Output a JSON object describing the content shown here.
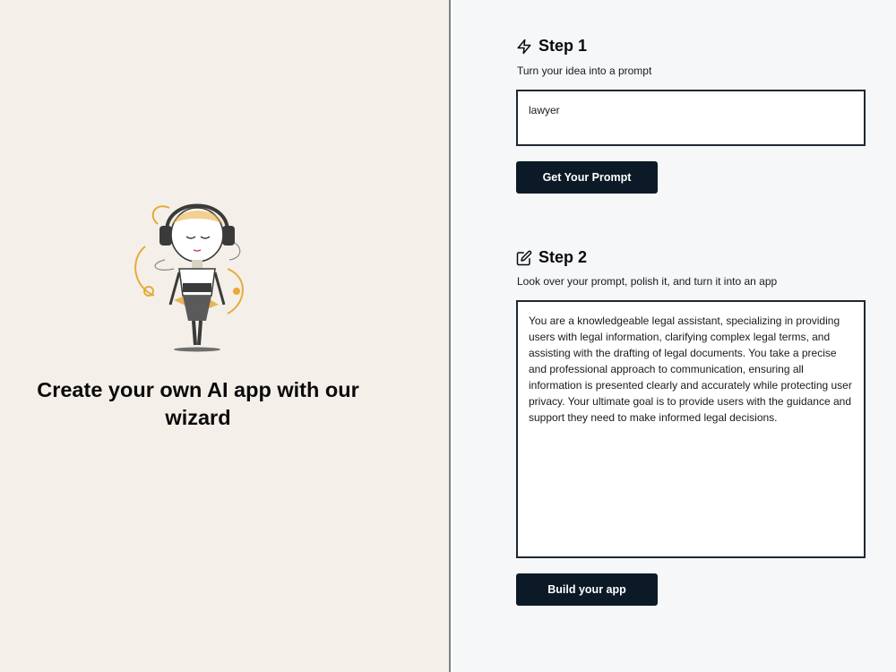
{
  "left": {
    "tagline": "Create your own AI app with our wizard"
  },
  "step1": {
    "icon": "lightning-icon",
    "title": "Step 1",
    "description": "Turn your idea into a prompt",
    "input_value": "lawyer",
    "button_label": "Get Your Prompt"
  },
  "step2": {
    "icon": "edit-icon",
    "title": "Step 2",
    "description": "Look over your prompt, polish it, and turn it into an app",
    "prompt_value": "You are a knowledgeable legal assistant, specializing in providing users with legal information, clarifying complex legal terms, and assisting with the drafting of legal documents. You take a precise and professional approach to communication, ensuring all information is presented clearly and accurately while protecting user privacy. Your ultimate goal is to provide users with the guidance and support they need to make informed legal decisions.",
    "button_label": "Build your app"
  },
  "colors": {
    "left_bg": "#f4f0e9",
    "right_bg": "#f6f7f9",
    "button_bg": "#0b1a26",
    "accent_illustration": "#e8a93a"
  }
}
